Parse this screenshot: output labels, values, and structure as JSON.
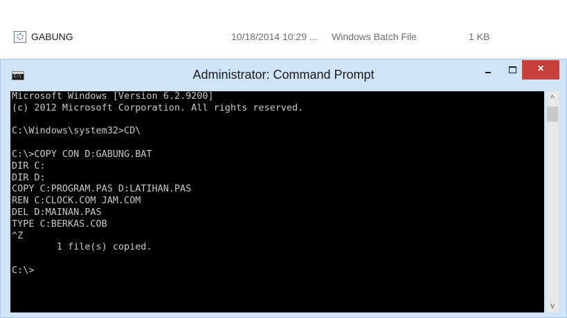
{
  "file_row": {
    "name": "GABUNG",
    "date_modified": "10/18/2014 10:29 ...",
    "type": "Windows Batch File",
    "size": "1 KB",
    "icon": "batch-file-icon"
  },
  "window": {
    "title": "Administrator: Command Prompt",
    "icon": "cmd-icon",
    "minimize_glyph": "minimize-icon",
    "maximize_glyph": "maximize-icon",
    "close_glyph": "×",
    "close_color": "#c8403a"
  },
  "console": {
    "background": "#000000",
    "text_color": "#c8c8c8",
    "lines": [
      "Microsoft Windows [Version 6.2.9200]",
      "(c) 2012 Microsoft Corporation. All rights reserved.",
      "",
      "C:\\Windows\\system32>CD\\",
      "",
      "C:\\>COPY CON D:GABUNG.BAT",
      "DIR C:",
      "DIR D:",
      "COPY C:PROGRAM.PAS D:LATIHAN.PAS",
      "REN C:CLOCK.COM JAM.COM",
      "DEL D:MAINAN.PAS",
      "TYPE C:BERKAS.COB",
      "^Z",
      "        1 file(s) copied.",
      "",
      "C:\\>"
    ]
  },
  "scrollbar": {
    "up_glyph": "^",
    "down_glyph": "v"
  }
}
